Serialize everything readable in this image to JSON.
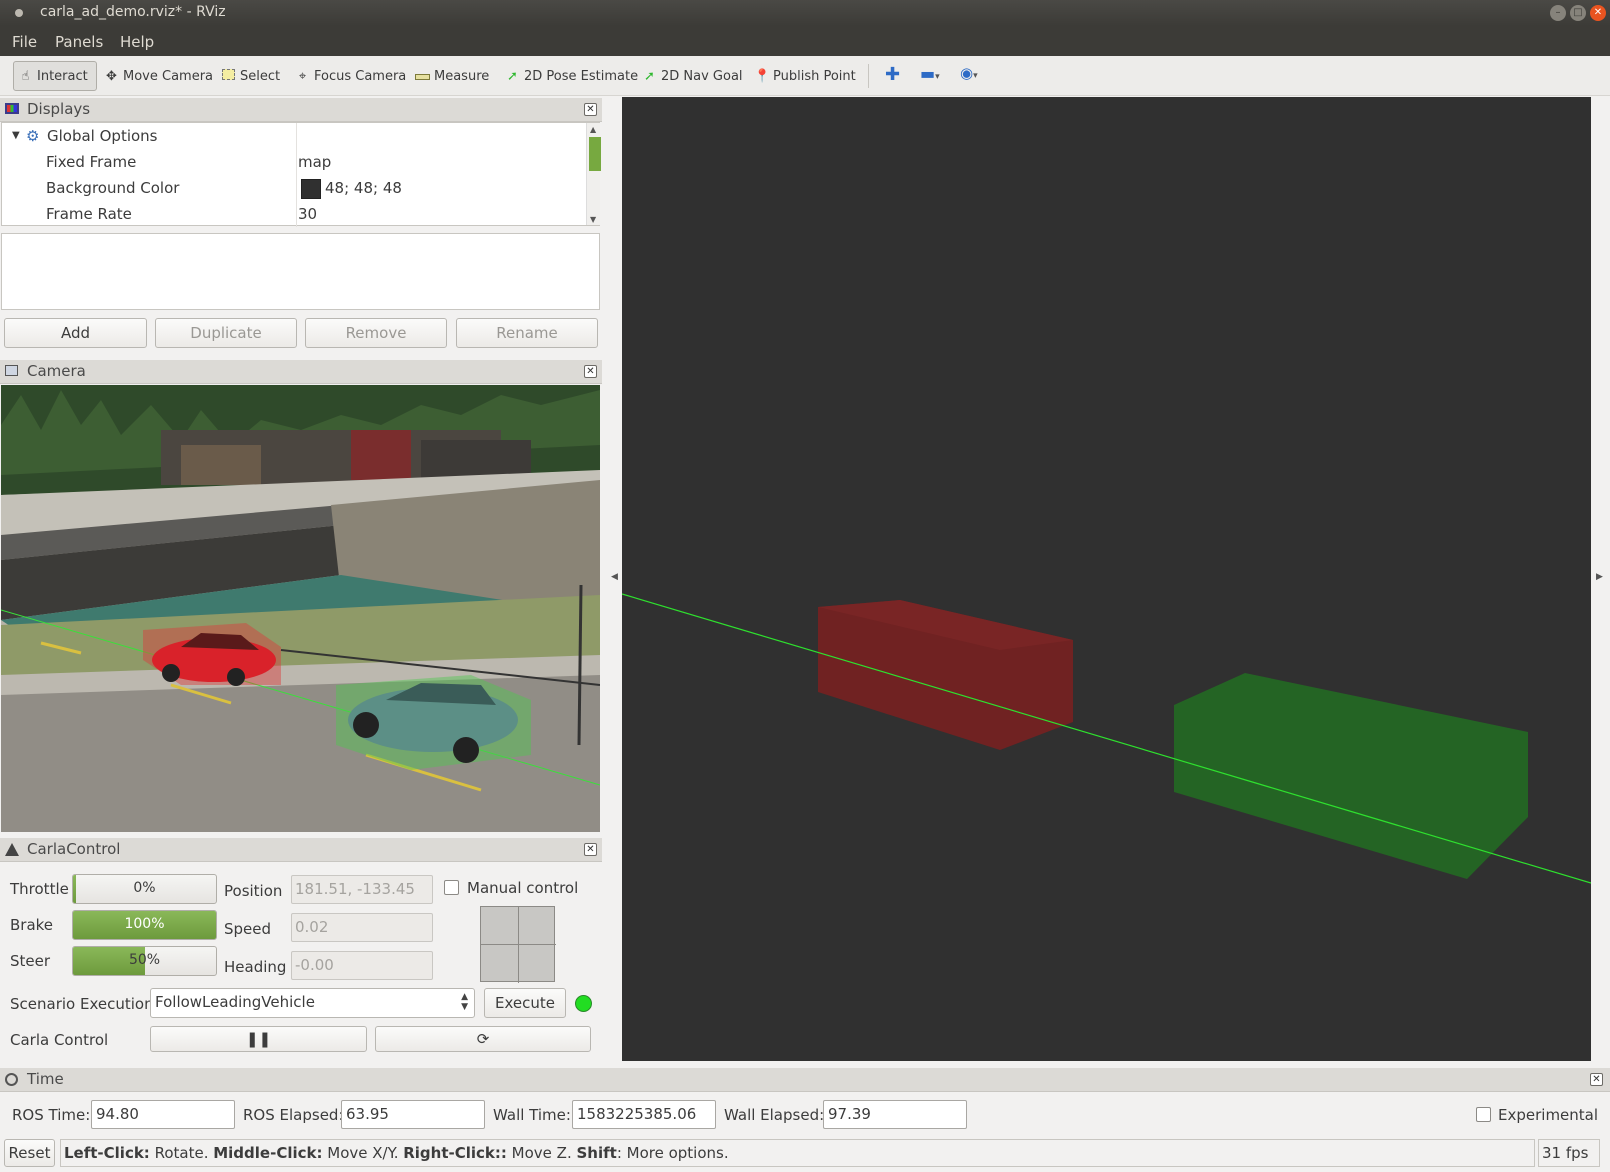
{
  "window": {
    "title": "carla_ad_demo.rviz* - RViz"
  },
  "menu": {
    "file": "File",
    "panels": "Panels",
    "help": "Help"
  },
  "toolbar": {
    "interact": "Interact",
    "move_camera": "Move Camera",
    "select": "Select",
    "focus_camera": "Focus Camera",
    "measure": "Measure",
    "pose_estimate": "2D Pose Estimate",
    "nav_goal": "2D Nav Goal",
    "publish_point": "Publish Point"
  },
  "displays": {
    "title": "Displays",
    "global_options": "Global Options",
    "rows": [
      {
        "key": "Fixed Frame",
        "value": "map"
      },
      {
        "key": "Background Color",
        "value": "48; 48; 48",
        "swatch": "#303030"
      },
      {
        "key": "Frame Rate",
        "value": "30"
      }
    ],
    "buttons": {
      "add": "Add",
      "duplicate": "Duplicate",
      "remove": "Remove",
      "rename": "Rename"
    }
  },
  "camera": {
    "title": "Camera"
  },
  "carla_control": {
    "title": "CarlaControl",
    "throttle": {
      "label": "Throttle",
      "value": 0,
      "text": "0%"
    },
    "brake": {
      "label": "Brake",
      "value": 100,
      "text": "100%"
    },
    "steer": {
      "label": "Steer",
      "value": 50,
      "text": "50%"
    },
    "position": {
      "label": "Position",
      "value": "181.51, -133.45"
    },
    "speed": {
      "label": "Speed",
      "value": "0.02"
    },
    "heading": {
      "label": "Heading",
      "value": "-0.00"
    },
    "manual_control": "Manual control",
    "scenario_label": "Scenario Execution",
    "scenario_value": "FollowLeadingVehicle",
    "execute": "Execute",
    "status_color": "#22dd22",
    "carla_control_label": "Carla Control"
  },
  "time": {
    "title": "Time",
    "ros_time_label": "ROS Time:",
    "ros_time": "94.80",
    "ros_elapsed_label": "ROS Elapsed:",
    "ros_elapsed": "63.95",
    "wall_time_label": "Wall Time:",
    "wall_time": "1583225385.06",
    "wall_elapsed_label": "Wall Elapsed:",
    "wall_elapsed": "97.39",
    "experimental": "Experimental"
  },
  "status": {
    "reset": "Reset",
    "left_click": "Left-Click:",
    "left_action": " Rotate. ",
    "middle_click": "Middle-Click:",
    "middle_action": " Move X/Y. ",
    "right_click": "Right-Click::",
    "right_action": " Move Z. ",
    "shift": "Shift",
    "shift_action": ": More options.",
    "fps": "31 fps"
  }
}
